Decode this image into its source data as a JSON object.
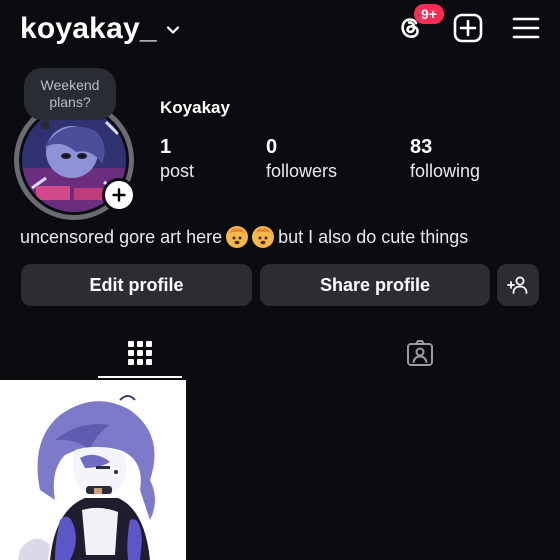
{
  "header": {
    "username": "koyakay_",
    "notification_badge": "9+"
  },
  "profile": {
    "display_name": "Koyakay",
    "note": "Weekend plans?",
    "stats": [
      {
        "value": "1",
        "label": "post"
      },
      {
        "value": "0",
        "label": "followers"
      },
      {
        "value": "83",
        "label": "following"
      }
    ],
    "bio": {
      "text_before": "uncensored gore art here",
      "text_after": "but I also do cute things"
    }
  },
  "actions": {
    "edit_profile": "Edit profile",
    "share_profile": "Share profile"
  },
  "icons": {
    "threads": "threads-icon",
    "new_post": "plus-square-icon",
    "menu": "hamburger-icon",
    "grid": "grid-icon",
    "tagged": "tagged-person-icon",
    "add_person": "add-person-icon",
    "chevron": "chevron-down-icon"
  },
  "colors": {
    "background": "#0b0c0f",
    "button_bg": "#2b2d33",
    "badge": "#ff2d55"
  }
}
